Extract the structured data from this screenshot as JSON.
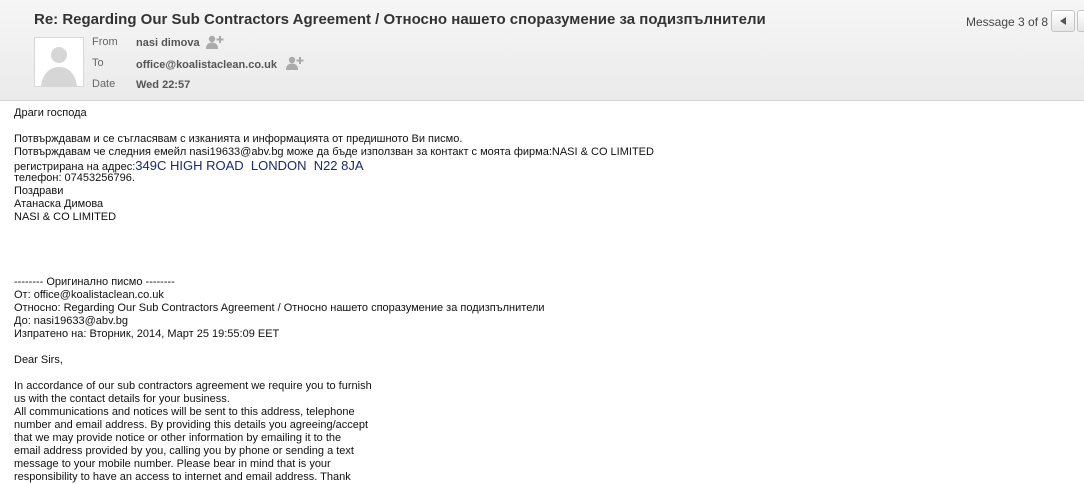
{
  "header": {
    "subject": "Re: Regarding Our Sub Contractors Agreement / Относно нашето споразумение за подизпълнители",
    "message_counter": "Message 3 of 8",
    "from_label": "From",
    "from_value": "nasi dimova",
    "to_label": "To",
    "to_value": "office@koalistaclean.co.uk",
    "date_label": "Date",
    "date_value": "Wed 22:57"
  },
  "body": {
    "greeting": "Драги господа",
    "p1_line1": "Потвърждавам и се съгласявам с изканията и информацията от предишното Ви писмо.",
    "p1_line2": "Потвърждавам че следния емейл nasi19633@abv.bg може да бъде използван за контакт с моята фирма:NASI & CO LIMITED",
    "p1_line3_prefix": "регистрирана на адрес:",
    "p1_line3_address": "349C HIGH ROAD  LONDON  N22 8JA",
    "p1_line4": "телефон: 07453256796.",
    "p1_line5": "Поздрави",
    "p1_line6": "Атанаска Димова",
    "p1_line7": "NASI & CO LIMITED",
    "quote_header": "-------- Оригинално писмо --------",
    "quote_from": "От: office@koalistaclean.co.uk",
    "quote_subject": "Относно: Regarding Our Sub Contractors Agreement / Относно нашето споразумение за подизпълнители",
    "quote_to": "До: nasi19633@abv.bg",
    "quote_sent": "Изпратено на: Вторник, 2014, Март 25 19:55:09 EET",
    "dear": "Dear Sirs,",
    "en_lines": [
      "In accordance of our sub contractors agreement we require you to furnish",
      "us with the contact details for your business.",
      "All communications and notices will be sent to this address, telephone",
      "number and email address. By providing this details you agreeing/accept",
      "that we may provide notice or other information by emailing it to the",
      "email address provided by you, calling you by phone or sending a text",
      "message to your mobile number. Please bear in mind that is your",
      "responsibility to have an access to internet and email address. Thank"
    ]
  }
}
